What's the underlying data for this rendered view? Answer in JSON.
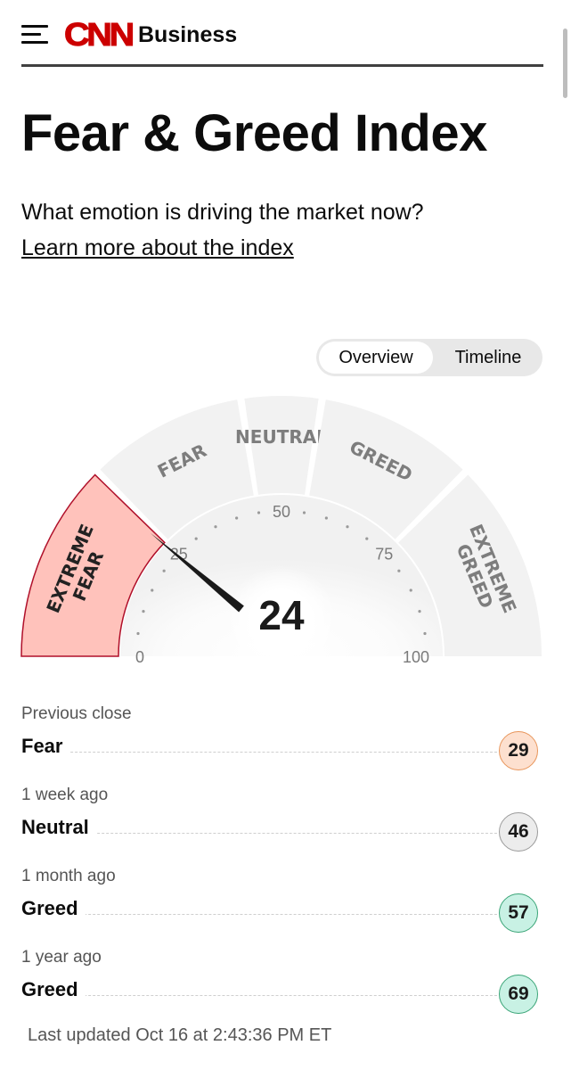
{
  "header": {
    "menu_icon": "hamburger-menu-icon",
    "logo_text": "CNN",
    "section": "Business",
    "logo_color": "#cc0000"
  },
  "page": {
    "title": "Fear & Greed Index",
    "subtitle": "What emotion is driving the market now?",
    "learn_more": "Learn more about the index"
  },
  "view_toggle": {
    "options": [
      "Overview",
      "Timeline"
    ],
    "selected": "Overview"
  },
  "gauge": {
    "value": 24,
    "min": 0,
    "max": 100,
    "ticks": [
      "0",
      "25",
      "50",
      "75",
      "100"
    ],
    "segments": [
      {
        "label_lines": [
          "EXTREME",
          "FEAR"
        ],
        "from": 0,
        "to": 25,
        "active": true
      },
      {
        "label_lines": [
          "FEAR"
        ],
        "from": 25,
        "to": 45,
        "active": false
      },
      {
        "label_lines": [
          "NEUTRAL"
        ],
        "from": 45,
        "to": 55,
        "active": false
      },
      {
        "label_lines": [
          "GREED"
        ],
        "from": 55,
        "to": 75,
        "active": false
      },
      {
        "label_lines": [
          "EXTREME",
          "GREED"
        ],
        "from": 75,
        "to": 100,
        "active": false
      }
    ],
    "colors": {
      "segment": "#f2f2f2",
      "active_fill": "#ffc2bb",
      "active_stroke": "#b0102a",
      "label": "#7d7d7d",
      "needle": "#1a1a1a"
    }
  },
  "history": [
    {
      "label": "Previous close",
      "rating": "Fear",
      "value": "29",
      "badge_bg": "#fde0cf",
      "badge_border": "#e8955a"
    },
    {
      "label": "1 week ago",
      "rating": "Neutral",
      "value": "46",
      "badge_bg": "#ececec",
      "badge_border": "#9a9a9a"
    },
    {
      "label": "1 month ago",
      "rating": "Greed",
      "value": "57",
      "badge_bg": "#c8f1e4",
      "badge_border": "#3aa577"
    },
    {
      "label": "1 year ago",
      "rating": "Greed",
      "value": "69",
      "badge_bg": "#c8f1e4",
      "badge_border": "#3aa577"
    }
  ],
  "last_updated": "Last updated Oct 16 at 2:43:36 PM ET"
}
